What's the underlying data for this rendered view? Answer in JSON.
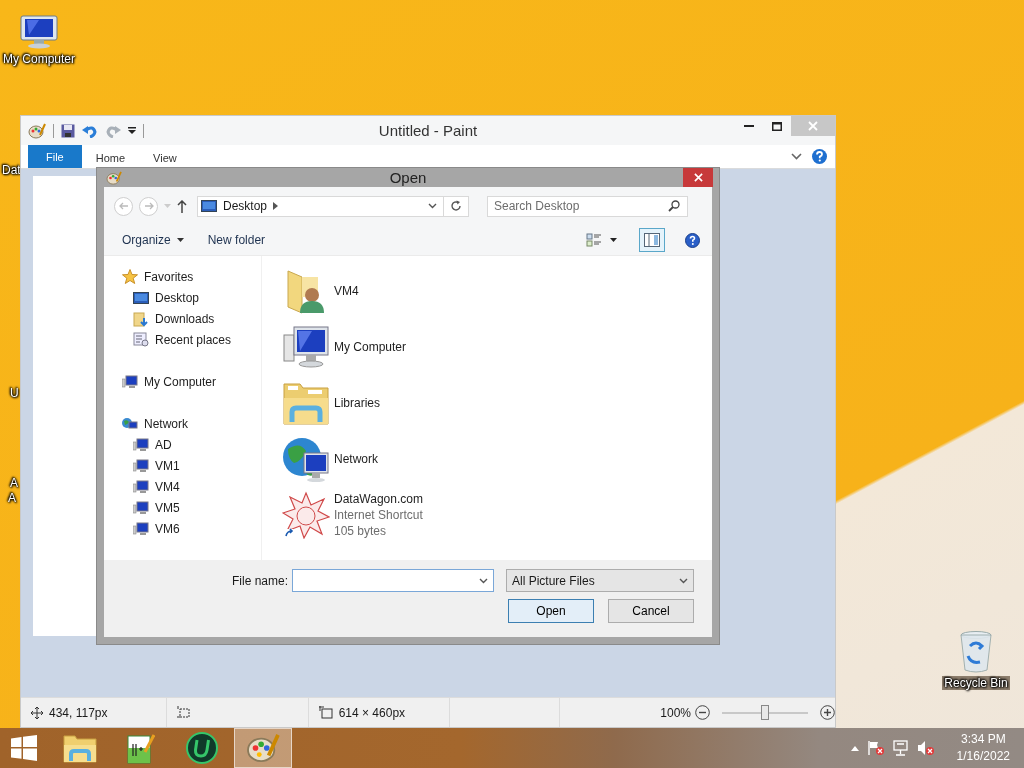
{
  "desktop": {
    "icons": [
      {
        "label": "My Computer",
        "kind": "computer"
      },
      {
        "label": "Recycle Bin",
        "kind": "recycle-bin"
      }
    ],
    "hidden_icon_labels": [
      "Dat",
      "U",
      "A",
      "A"
    ]
  },
  "paint": {
    "title": "Untitled - Paint",
    "ribbon_tabs": [
      {
        "label": "File",
        "kind": "application"
      },
      {
        "label": "Home",
        "kind": "tab"
      },
      {
        "label": "View",
        "kind": "tab"
      }
    ],
    "status_bar": {
      "cursor_position": "434, 117px",
      "image_size": "614 × 460px",
      "zoom": "100%",
      "zoom_slider": {
        "level": 0.5
      }
    }
  },
  "open_dialog": {
    "title": "Open",
    "address": "Desktop",
    "search": {
      "placeholder": "Search Desktop"
    },
    "toolbar": [
      {
        "label": "Organize",
        "kind": "menu"
      },
      {
        "label": "New folder",
        "kind": "command"
      }
    ],
    "nav_tree": [
      {
        "label": "Favorites",
        "kind": "star",
        "children": [
          {
            "label": "Desktop",
            "kind": "desktop"
          },
          {
            "label": "Downloads",
            "kind": "downloads"
          },
          {
            "label": "Recent places",
            "kind": "recent"
          }
        ]
      },
      {
        "label": "My Computer",
        "kind": "computer"
      },
      {
        "label": "Network",
        "kind": "network",
        "children": [
          {
            "label": "AD",
            "kind": "computer"
          },
          {
            "label": "VM1",
            "kind": "computer"
          },
          {
            "label": "VM4",
            "kind": "computer"
          },
          {
            "label": "VM5",
            "kind": "computer"
          },
          {
            "label": "VM6",
            "kind": "computer"
          }
        ]
      }
    ],
    "files": [
      {
        "name": "VM4",
        "kind": "user-folder"
      },
      {
        "name": "My Computer",
        "kind": "computer"
      },
      {
        "name": "Libraries",
        "kind": "libraries"
      },
      {
        "name": "Network",
        "kind": "network"
      },
      {
        "name": "DataWagon.com",
        "kind": "shortcut",
        "details": [
          "Internet Shortcut",
          "105 bytes"
        ]
      }
    ],
    "file_name_label": "File name:",
    "file_type": "All Picture Files",
    "buttons": [
      {
        "label": "Open",
        "kind": "default"
      },
      {
        "label": "Cancel",
        "kind": "normal"
      }
    ]
  },
  "taskbar": {
    "apps": [
      {
        "kind": "explorer",
        "active": false
      },
      {
        "kind": "notepad",
        "active": false
      },
      {
        "kind": "u-app",
        "active": false
      },
      {
        "kind": "paint",
        "active": true
      }
    ],
    "time": "3:34 PM",
    "date": "1/16/2022"
  }
}
